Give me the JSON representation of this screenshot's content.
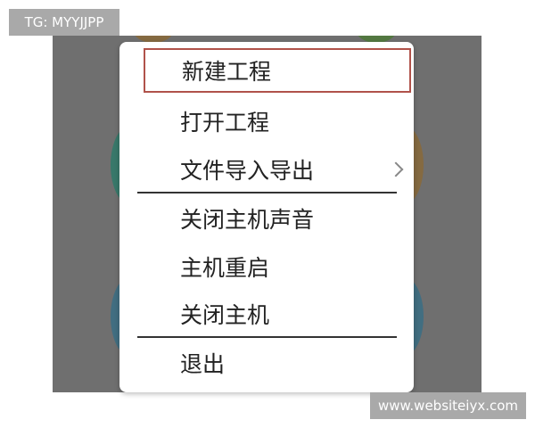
{
  "watermarks": {
    "top_left": "TG: MYYJJPP",
    "bottom_right": "www.websiteiyx.com"
  },
  "menu": {
    "items": [
      {
        "label": "新建工程",
        "selected": true
      },
      {
        "label": "打开工程"
      },
      {
        "label": "文件导入导出",
        "has_submenu": true
      },
      {
        "label": "关闭主机声音"
      },
      {
        "label": "主机重启"
      },
      {
        "label": "关闭主机"
      },
      {
        "label": "退出"
      }
    ]
  },
  "colors": {
    "selected_border": "#b0524a",
    "overlay": "#6f6f6f"
  }
}
